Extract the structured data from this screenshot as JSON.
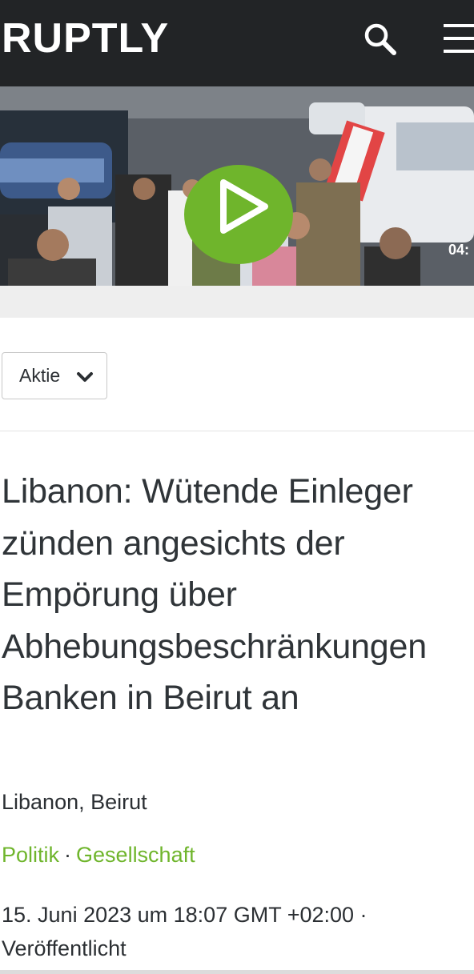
{
  "header": {
    "logo_text": "RUPTLY",
    "bg_color": "#222426"
  },
  "icons": {
    "search": "search-icon",
    "menu": "hamburger-menu-icon",
    "play": "play-icon",
    "chevron": "chevron-down-icon"
  },
  "video": {
    "duration": "04:",
    "accent_color": "#6fb52c"
  },
  "filter": {
    "dropdown_label": "Aktie"
  },
  "article": {
    "title": "Libanon: Wütende Einleger zünden angesichts der Empörung über Abhebungsbeschränkungen Banken in Beirut an",
    "location": "Libanon, Beirut",
    "tags": [
      "Politik",
      "Gesellschaft"
    ],
    "tag_separator": "·",
    "date": "15. Juni 2023 um 18:07 GMT +02:00 · Veröffentlicht"
  }
}
